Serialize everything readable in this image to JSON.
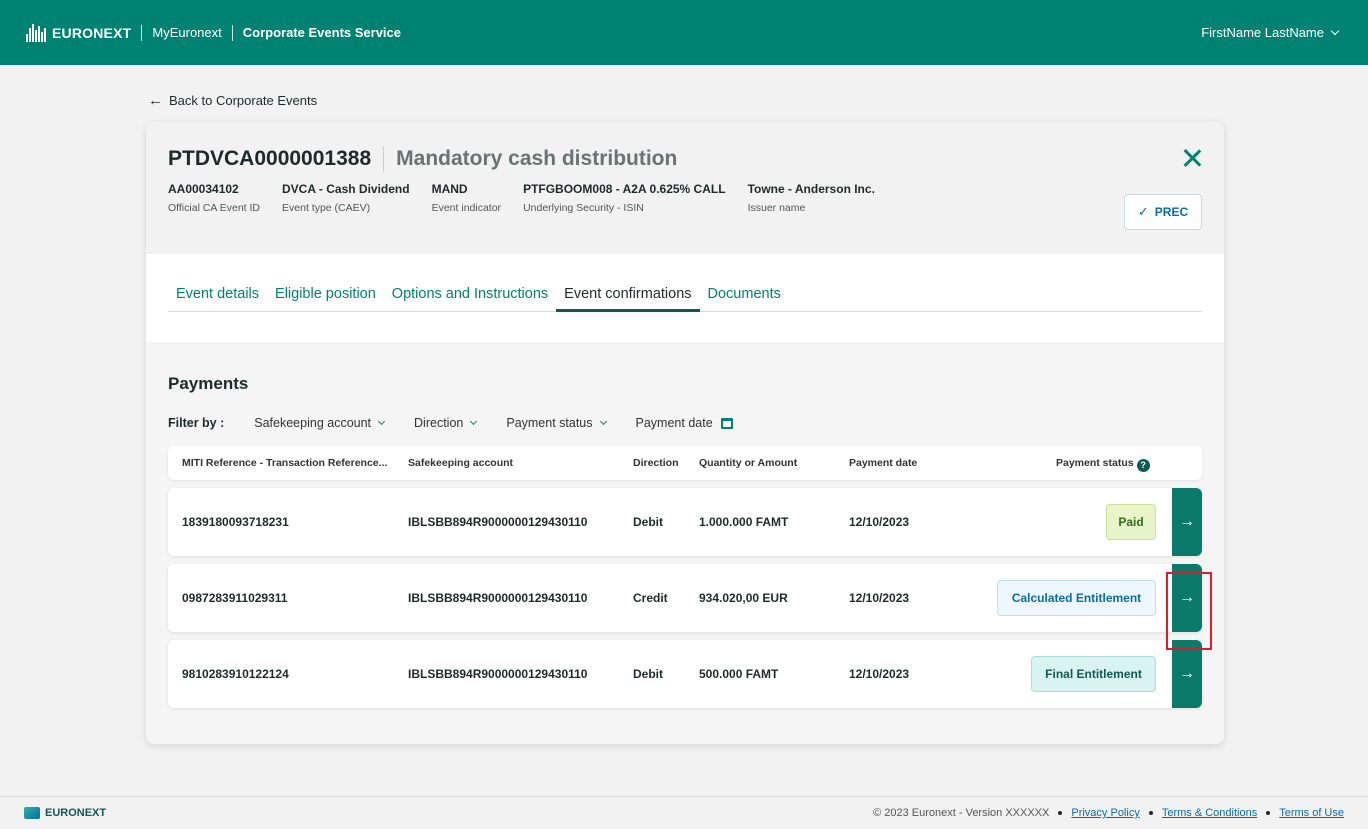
{
  "header": {
    "logo_text": "EURONEXT",
    "nav_link": "MyEuronext",
    "service": "Corporate Events Service",
    "user_name": "FirstName LastName"
  },
  "back_link": "Back to Corporate Events",
  "event": {
    "id": "PTDVCA0000001388",
    "name": "Mandatory cash distribution",
    "meta": [
      {
        "value": "AA00034102",
        "label": "Official CA Event ID"
      },
      {
        "value": "DVCA - Cash Dividend",
        "label": "Event type (CAEV)"
      },
      {
        "value": "MAND",
        "label": "Event indicator"
      },
      {
        "value": "PTFGBOOM008 - A2A 0.625% CALL",
        "label": "Underlying Security - ISIN"
      },
      {
        "value": "Towne - Anderson Inc.",
        "label": "Issuer name"
      }
    ],
    "prec_label": "PREC"
  },
  "tabs": [
    "Event details",
    "Eligible position",
    "Options and Instructions",
    "Event confirmations",
    "Documents"
  ],
  "active_tab": "Event confirmations",
  "payments": {
    "title": "Payments",
    "filter_label": "Filter by :",
    "filters": [
      "Safekeeping account",
      "Direction",
      "Payment status",
      "Payment date"
    ],
    "columns": [
      "MITI Reference - Transaction Reference...",
      "Safekeeping account",
      "Direction",
      "Quantity or Amount",
      "Payment date",
      "Payment status"
    ],
    "rows": [
      {
        "ref": "1839180093718231",
        "account": "IBLSBB894R9000000129430110",
        "direction": "Debit",
        "amount": "1.000.000 FAMT",
        "date": "12/10/2023",
        "status": "Paid"
      },
      {
        "ref": "0987283911029311",
        "account": "IBLSBB894R9000000129430110",
        "direction": "Credit",
        "amount": "934.020,00 EUR",
        "date": "12/10/2023",
        "status": "Calculated Entitlement"
      },
      {
        "ref": "9810283910122124",
        "account": "IBLSBB894R9000000129430110",
        "direction": "Debit",
        "amount": "500.000 FAMT",
        "date": "12/10/2023",
        "status": "Final Entitlement"
      }
    ]
  },
  "footer": {
    "logo_text": "EURONEXT",
    "copyright": "© 2023 Euronext - Version XXXXXX",
    "links": [
      "Privacy Policy",
      "Terms & Conditions",
      "Terms of Use"
    ]
  },
  "colors": {
    "brand": "#008272",
    "accent": "#0b6aa8",
    "highlight": "#d9202a"
  }
}
